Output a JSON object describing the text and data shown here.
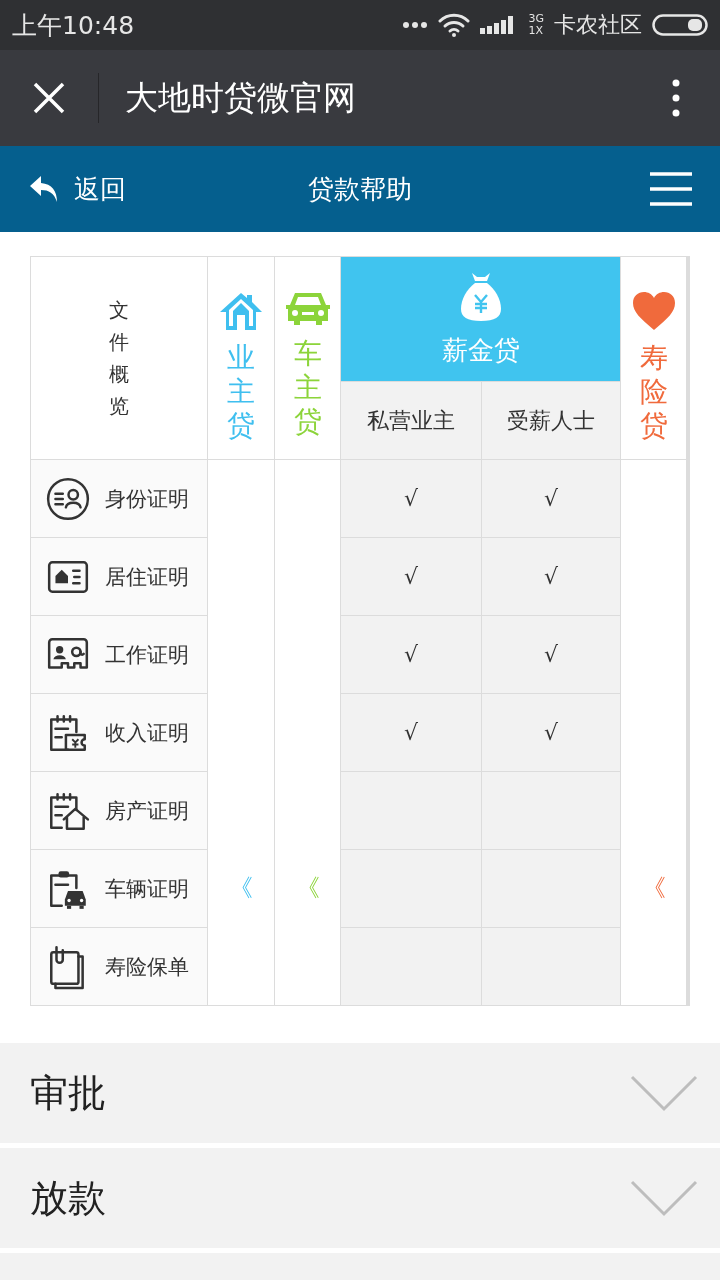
{
  "status_bar": {
    "time": "上午10:48",
    "network_top": "3G",
    "network_bottom": "1X",
    "carrier": "卡农社区"
  },
  "title_bar": {
    "title": "大地时贷微官网"
  },
  "nav_bar": {
    "back": "返回",
    "title": "贷款帮助"
  },
  "table": {
    "overview": "文件概览",
    "products": [
      {
        "name": "业主贷",
        "kind": "single",
        "color": "#3fbfef"
      },
      {
        "name": "车主贷",
        "kind": "single",
        "color": "#8cd43a"
      },
      {
        "name": "薪金贷",
        "kind": "group",
        "color": "#40c4ef",
        "subcolumns": [
          "私营业主",
          "受薪人士"
        ]
      },
      {
        "name": "寿险贷",
        "kind": "single",
        "color": "#f06a3c"
      }
    ],
    "rows": [
      {
        "label": "身份证明",
        "checks": [
          "√",
          "√"
        ]
      },
      {
        "label": "居住证明",
        "checks": [
          "√",
          "√"
        ]
      },
      {
        "label": "工作证明",
        "checks": [
          "√",
          "√"
        ]
      },
      {
        "label": "收入证明",
        "checks": [
          "√",
          "√"
        ]
      },
      {
        "label": "房产证明"
      },
      {
        "label": "车辆证明",
        "pointers": [
          "《",
          "《",
          "《"
        ]
      },
      {
        "label": "寿险保单"
      }
    ]
  },
  "sections": [
    {
      "title": "审批",
      "expanded": false
    },
    {
      "title": "放款",
      "expanded": false
    }
  ]
}
